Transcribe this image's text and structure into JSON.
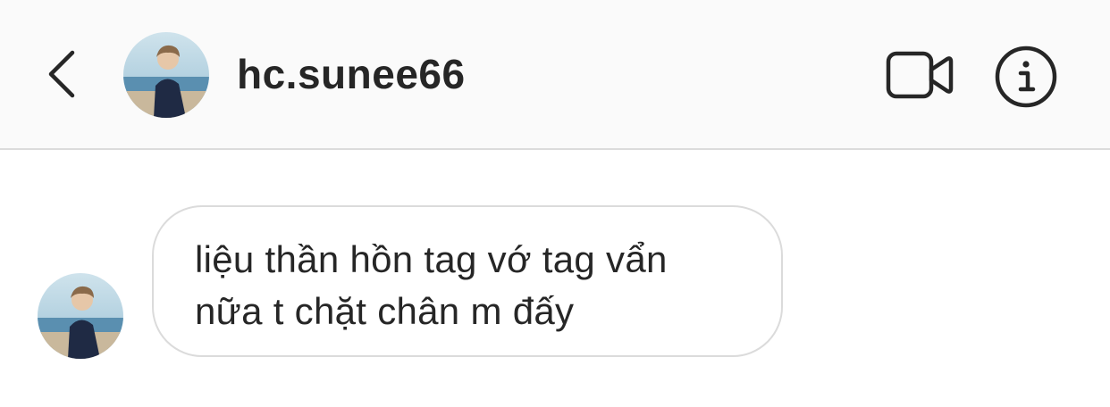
{
  "header": {
    "username": "hc.sunee66",
    "back_icon": "chevron-left-icon",
    "video_icon": "video-camera-icon",
    "info_icon": "info-icon"
  },
  "messages": [
    {
      "sender": "hc.sunee66",
      "text": "liệu thần hồn tag vớ tag vẩn\nnữa t chặt chân m đấy"
    }
  ],
  "colors": {
    "header_bg": "#fafafa",
    "divider": "#dbdbdb",
    "text": "#262626",
    "bubble_border": "#dbdbdb"
  }
}
